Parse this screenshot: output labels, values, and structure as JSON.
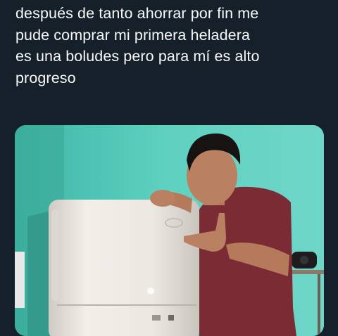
{
  "tweet": {
    "text_lines": [
      "después de tanto ahorrar por fin me",
      "pude comprar mi primera heladera",
      "es una boludes pero para mí es alto",
      "progreso"
    ]
  },
  "media": {
    "description_icon": "photo-icon"
  },
  "colors": {
    "background": "#15202b",
    "text": "#f7f9f9",
    "wall": "#52c7b8",
    "fridge": "#eeeae4",
    "shirt": "#7a2b33"
  }
}
